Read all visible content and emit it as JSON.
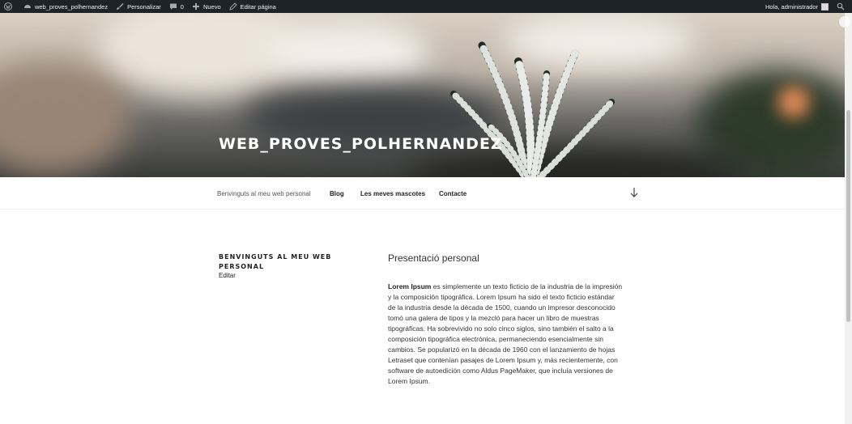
{
  "adminbar": {
    "site_name": "web_proves_polhernandez",
    "customize": "Personalizar",
    "comments_count": "0",
    "new": "Nuevo",
    "edit_page": "Editar página",
    "greeting": "Hola, administrador"
  },
  "header": {
    "site_title": "WEB_PROVES_POLHERNANDEZ"
  },
  "nav": {
    "items": [
      {
        "label": "Benvinguts al meu web personal"
      },
      {
        "label": "Blog"
      },
      {
        "label": "Les meves mascotes"
      },
      {
        "label": "Contacte"
      }
    ]
  },
  "page": {
    "title": "BENVINGUTS AL MEU WEB PERSONAL",
    "edit": "Editar",
    "entry_heading": "Presentació personal",
    "entry_bold": "Lorem Ipsum",
    "entry_text": " es simplemente un texto ficticio de la industria de la impresión y la composición tipográfica. Lorem Ipsum ha sido el texto ficticio estándar de la industria desde la década de 1500, cuando un impresor desconocido tomó una galera de tipos y la mezcló para hacer un libro de muestras tipográficas. Ha sobrevivido no solo cinco siglos, sino también el salto a la composición tipográfica electrónica, permaneciendo esencialmente sin cambios. Se popularizó en la década de 1960 con el lanzamiento de hojas Letraset que contenían pasajes de Lorem Ipsum y, más recientemente, con software de autoedición como Aldus PageMaker, que incluía versiones de Lorem Ipsum."
  },
  "colors": {
    "adminbar_bg": "#1d2327",
    "text": "#333333"
  }
}
